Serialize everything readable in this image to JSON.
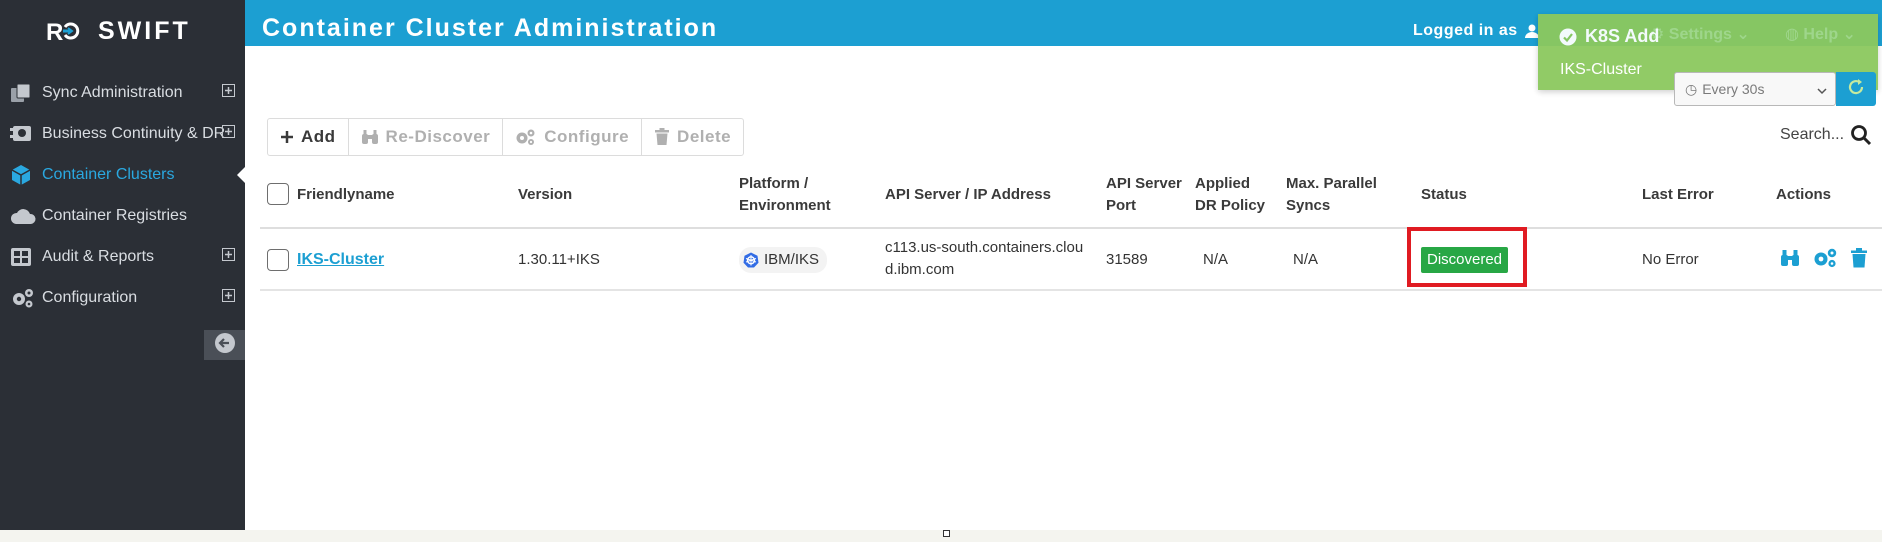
{
  "brand": {
    "text": "SWIFT"
  },
  "sidebar": {
    "items": [
      {
        "label": "Sync Administration",
        "icon": "copy-icon",
        "expandable": true
      },
      {
        "label": "Business Continuity & DR",
        "icon": "server-sync-icon",
        "expandable": true
      },
      {
        "label": "Container Clusters",
        "icon": "cube-icon",
        "expandable": false,
        "active": true
      },
      {
        "label": "Container Registries",
        "icon": "cloud-icon",
        "expandable": false
      },
      {
        "label": "Audit & Reports",
        "icon": "grid-icon",
        "expandable": true
      },
      {
        "label": "Configuration",
        "icon": "gears-icon",
        "expandable": true
      }
    ]
  },
  "header": {
    "title": "Container Cluster Administration",
    "logged_in": "Logged in as",
    "settings": "Settings",
    "help": "Help"
  },
  "toast": {
    "title": "K8S Add",
    "message": "IKS-Cluster"
  },
  "refresh": {
    "value": "Every 30s"
  },
  "toolbar": {
    "add": "Add",
    "rediscover": "Re-Discover",
    "configure": "Configure",
    "delete": "Delete"
  },
  "search": {
    "label": "Search..."
  },
  "table": {
    "headers": {
      "friendlyname": "Friendlyname",
      "version": "Version",
      "platform_1": "Platform /",
      "platform_2": "Environment",
      "api_server": "API Server / IP Address",
      "api_port_1": "API Server",
      "api_port_2": "Port",
      "dr_policy_1": "Applied",
      "dr_policy_2": "DR Policy",
      "parallel_1": "Max. Parallel",
      "parallel_2": "Syncs",
      "status": "Status",
      "last_error": "Last Error",
      "actions": "Actions"
    },
    "rows": [
      {
        "friendlyname": "IKS-Cluster",
        "version": "1.30.11+IKS",
        "platform": "IBM/IKS",
        "api_server_1": "c113.us-south.containers.clou",
        "api_server_2": "d.ibm.com",
        "api_port": "31589",
        "dr_policy": "N/A",
        "parallel": "N/A",
        "status": "Discovered",
        "last_error": "No Error"
      }
    ]
  },
  "colors": {
    "sidebar_bg": "#2b2f36",
    "header_bg": "#1c9fd2",
    "accent": "#1c9fd2",
    "toast_bg": "#8cc95e",
    "status_ok": "#28a745",
    "highlight": "#e01b22"
  }
}
